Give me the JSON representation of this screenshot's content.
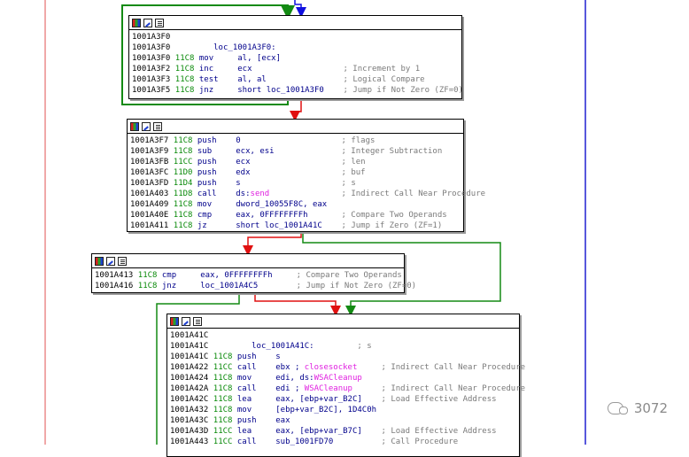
{
  "blocks": [
    {
      "lines": [
        {
          "addr": "1001A3F0",
          "sp": "",
          "mn": "",
          "ops": "",
          "cmt": ""
        },
        {
          "addr": "1001A3F0",
          "sp": "",
          "mn": "",
          "ops": "loc_1001A3F0:",
          "cmt": ""
        },
        {
          "addr": "1001A3F0",
          "sp": "11C8",
          "mn": "mov",
          "ops": "al, [ecx]",
          "cmt": ""
        },
        {
          "addr": "1001A3F2",
          "sp": "11C8",
          "mn": "inc",
          "ops": "ecx",
          "cmt": "; Increment by 1"
        },
        {
          "addr": "1001A3F3",
          "sp": "11C8",
          "mn": "test",
          "ops": "al, al",
          "cmt": "; Logical Compare"
        },
        {
          "addr": "1001A3F5",
          "sp": "11C8",
          "mn": "jnz",
          "ops": "short loc_1001A3F0",
          "cmt": "; Jump if Not Zero (ZF=0)"
        }
      ]
    },
    {
      "lines": [
        {
          "addr": "1001A3F7",
          "sp": "11C8",
          "mn": "push",
          "ops": "0",
          "cmt": "; flags"
        },
        {
          "addr": "1001A3F9",
          "sp": "11C8",
          "mn": "sub",
          "ops": "ecx, esi",
          "cmt": "; Integer Subtraction"
        },
        {
          "addr": "1001A3FB",
          "sp": "11CC",
          "mn": "push",
          "ops": "ecx",
          "cmt": "; len"
        },
        {
          "addr": "1001A3FC",
          "sp": "11D0",
          "mn": "push",
          "ops": "edx",
          "cmt": "; buf"
        },
        {
          "addr": "1001A3FD",
          "sp": "11D4",
          "mn": "push",
          "ops": "s",
          "cmt": "; s"
        },
        {
          "addr": "1001A403",
          "sp": "11D8",
          "mn": "call",
          "ops": "ds:send",
          "cmt": "; Indirect Call Near Procedure"
        },
        {
          "addr": "1001A409",
          "sp": "11C8",
          "mn": "mov",
          "ops": "dword_10055F8C, eax",
          "cmt": ""
        },
        {
          "addr": "1001A40E",
          "sp": "11C8",
          "mn": "cmp",
          "ops": "eax, 0FFFFFFFFh",
          "cmt": "; Compare Two Operands"
        },
        {
          "addr": "1001A411",
          "sp": "11C8",
          "mn": "jz",
          "ops": "short loc_1001A41C",
          "cmt": "; Jump if Zero (ZF=1)"
        }
      ]
    },
    {
      "lines": [
        {
          "addr": "1001A413",
          "sp": "11C8",
          "mn": "cmp",
          "ops": "eax, 0FFFFFFFFh",
          "cmt": "; Compare Two Operands"
        },
        {
          "addr": "1001A416",
          "sp": "11C8",
          "mn": "jnz",
          "ops": "loc_1001A4C5",
          "cmt": "; Jump if Not Zero (ZF=0)"
        }
      ]
    },
    {
      "lines": [
        {
          "addr": "1001A41C",
          "sp": "",
          "mn": "",
          "ops": "",
          "cmt": ""
        },
        {
          "addr": "1001A41C",
          "sp": "",
          "mn": "",
          "ops": "loc_1001A41C:",
          "cmt": "; s"
        },
        {
          "addr": "1001A41C",
          "sp": "11C8",
          "mn": "push",
          "ops": "s",
          "cmt": ""
        },
        {
          "addr": "1001A422",
          "sp": "11CC",
          "mn": "call",
          "ops": "ebx ; closesocket",
          "cmt": "; Indirect Call Near Procedure"
        },
        {
          "addr": "1001A424",
          "sp": "11C8",
          "mn": "mov",
          "ops": "edi, ds:WSACleanup",
          "cmt": ""
        },
        {
          "addr": "1001A42A",
          "sp": "11C8",
          "mn": "call",
          "ops": "edi ; WSACleanup",
          "cmt": "; Indirect Call Near Procedure"
        },
        {
          "addr": "1001A42C",
          "sp": "11C8",
          "mn": "lea",
          "ops": "eax, [ebp+var_B2C]",
          "cmt": "; Load Effective Address"
        },
        {
          "addr": "1001A432",
          "sp": "11C8",
          "mn": "mov",
          "ops": "[ebp+var_B2C], 1D4C0h",
          "cmt": ""
        },
        {
          "addr": "1001A43C",
          "sp": "11C8",
          "mn": "push",
          "ops": "eax",
          "cmt": ""
        },
        {
          "addr": "1001A43D",
          "sp": "11CC",
          "mn": "lea",
          "ops": "eax, [ebp+var_B7C]",
          "cmt": "; Load Effective Address"
        },
        {
          "addr": "1001A443",
          "sp": "11CC",
          "mn": "call",
          "ops": "sub_1001FD70",
          "cmt": "; Call Procedure"
        }
      ]
    }
  ],
  "watermark": {
    "text": "3072"
  },
  "colors": {
    "true_edge": "#138a13",
    "false_edge": "#e01010",
    "flow_edge": "#1010e0",
    "left_line": "#e05050",
    "right_line": "#2020d0"
  }
}
